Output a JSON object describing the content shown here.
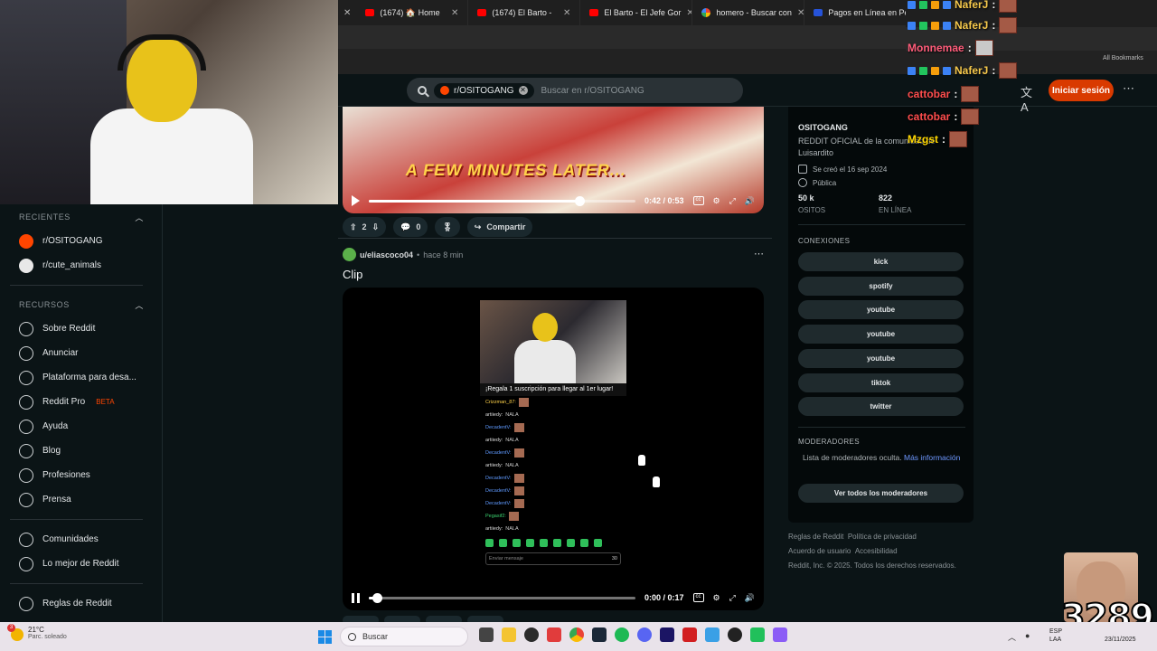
{
  "browser": {
    "tabs": [
      {
        "label": "(1674) 🏠 Home",
        "favicon": "youtube"
      },
      {
        "label": "(1674) El Barto - ",
        "favicon": "youtube"
      },
      {
        "label": "El Barto - El Jefe Gor",
        "favicon": "youtube"
      },
      {
        "label": "homero - Buscar con",
        "favicon": "google"
      },
      {
        "label": "Pagos en Línea en Pe",
        "favicon": "paypal"
      }
    ]
  },
  "header": {
    "subreddit_chip": "r/OSITOGANG",
    "search_placeholder": "Buscar en r/OSITOGANG",
    "login_label": "Iniciar sesión",
    "translate_icon": "translate-icon",
    "more_icon": "⋯"
  },
  "sidebar": {
    "recent_heading": "RECIENTES",
    "recent_items": [
      {
        "label": "r/OSITOGANG"
      },
      {
        "label": "r/cute_animals"
      }
    ],
    "resources_heading": "RECURSOS",
    "resource_items": [
      {
        "label": "Sobre Reddit"
      },
      {
        "label": "Anunciar"
      },
      {
        "label": "Plataforma para desa..."
      },
      {
        "label": "Reddit Pro",
        "badge": "BETA"
      },
      {
        "label": "Ayuda"
      },
      {
        "label": "Blog"
      },
      {
        "label": "Profesiones"
      },
      {
        "label": "Prensa"
      }
    ],
    "community_items": [
      {
        "label": "Comunidades"
      },
      {
        "label": "Lo mejor de Reddit"
      }
    ],
    "policy_items": [
      {
        "label": "Reglas de Reddit"
      }
    ]
  },
  "post1": {
    "video_caption": "A FEW MINUTES LATER...",
    "time_current": "0:42",
    "time_total": "0:53",
    "progress": 0.79,
    "votes": "2",
    "comments": "0",
    "share_label": "Compartir"
  },
  "post2": {
    "author": "u/eliascoco04",
    "time": "hace 8 min",
    "title": "Clip",
    "time_current": "0:00",
    "time_total": "0:17",
    "progress": 0.03,
    "inner": {
      "sub_banner": "¡Regala 1 suscripción para llegar al 1er lugar!",
      "message_placeholder": "Enviar mensaje",
      "points": "30",
      "chat": [
        {
          "name": "Crizzman_87:",
          "color": "y",
          "text": ""
        },
        {
          "name": "artiiedy:",
          "color": "w",
          "text": "NALA"
        },
        {
          "name": "DecadentV:",
          "color": "b",
          "text": ""
        },
        {
          "name": "artiiedy:",
          "color": "w",
          "text": "NALA"
        },
        {
          "name": "DecadentV:",
          "color": "b",
          "text": ""
        },
        {
          "name": "artiiedy:",
          "color": "w",
          "text": "NALA"
        },
        {
          "name": "DecadentV:",
          "color": "b",
          "text": ""
        },
        {
          "name": "DecadentV:",
          "color": "b",
          "text": ""
        },
        {
          "name": "DecadentV:",
          "color": "b",
          "text": ""
        },
        {
          "name": "Pegasif2:",
          "color": "g",
          "text": ""
        },
        {
          "name": "artiiedy:",
          "color": "w",
          "text": "NALA"
        }
      ]
    }
  },
  "community": {
    "name": "OSITOGANG",
    "description": "REDDIT OFICIAL de la comunidad de Luisardito",
    "created": "Se creó el 16 sep 2024",
    "visibility": "Pública",
    "members_value": "50 k",
    "members_label": "OSITOS",
    "online_value": "822",
    "online_label": "EN LÍNEA",
    "connections_heading": "CONEXIONES",
    "connections": [
      "kick",
      "spotify",
      "youtube",
      "youtube",
      "youtube",
      "tiktok",
      "twitter"
    ],
    "mods_heading": "MODERADORES",
    "mods_text": "Lista de moderadores oculta.",
    "mods_link": "Más información",
    "mods_button": "Ver todos los moderadores"
  },
  "footer": {
    "line1a": "Reglas de Reddit",
    "line1b": "Política de privacidad",
    "line2a": "Acuerdo de usuario",
    "line2b": "Accesibilidad",
    "line3": "Reddit, Inc. © 2025. Todos los derechos reservados."
  },
  "stream_chat": [
    {
      "name": "NaferJ",
      "color": "#f5c84b",
      "badges": 4
    },
    {
      "name": "NaferJ",
      "color": "#f5c84b",
      "badges": 4
    },
    {
      "name": "Monnemae",
      "color": "#ff5c7a",
      "badges": 0
    },
    {
      "name": "NaferJ",
      "color": "#f5c84b",
      "badges": 4
    },
    {
      "name": "cattobar",
      "color": "#ff4d4d",
      "badges": 0
    },
    {
      "name": "cattobar",
      "color": "#ff4d4d",
      "badges": 0
    },
    {
      "name": "Mzgst",
      "color": "#ffd700",
      "badges": 0
    }
  ],
  "bookmarks_label": "All Bookmarks",
  "overlay_number": "3289",
  "taskbar": {
    "temp": "21°C",
    "weather": "Parc. soleado",
    "search_label": "Buscar",
    "lang1": "ESP",
    "lang2": "LAA",
    "date": "23/11/2025"
  }
}
